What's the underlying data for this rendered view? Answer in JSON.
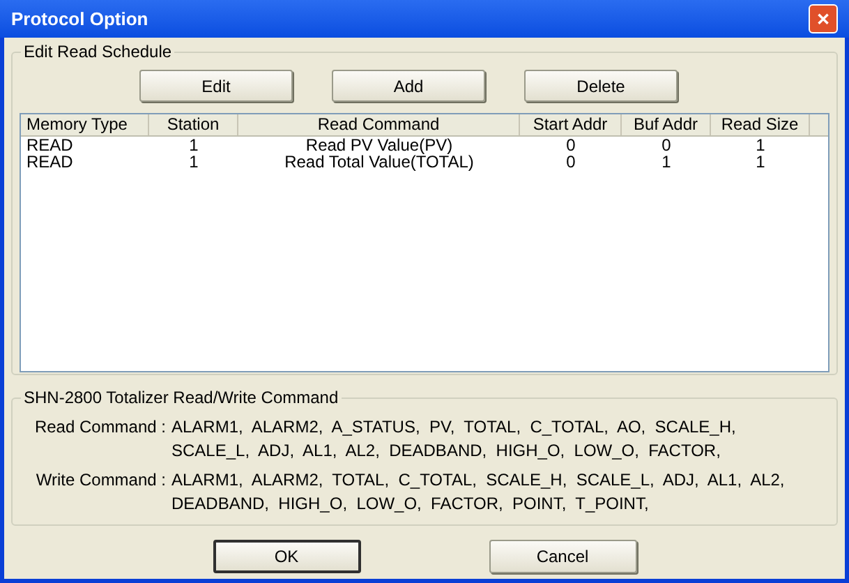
{
  "window": {
    "title": "Protocol Option",
    "close": "✕"
  },
  "schedule": {
    "title": "Edit Read Schedule",
    "buttons": [
      "Edit",
      "Add",
      "Delete"
    ],
    "table": {
      "columns": [
        "Memory Type",
        "Station",
        "Read Command",
        "Start Addr",
        "Buf Addr",
        "Read Size"
      ],
      "rows": [
        [
          "READ",
          "1",
          "Read PV Value(PV)",
          "0",
          "0",
          "1"
        ],
        [
          "READ",
          "1",
          "Read Total Value(TOTAL)",
          "0",
          "1",
          "1"
        ]
      ]
    }
  },
  "commands": {
    "title": "SHN-2800 Totalizer Read/Write Command",
    "items": [
      {
        "label": "Read Command :",
        "value": "ALARM1,  ALARM2,  A_STATUS,  PV,  TOTAL,  C_TOTAL,  AO,  SCALE_H,  SCALE_L,  ADJ,  AL1,  AL2,  DEADBAND,  HIGH_O,  LOW_O,  FACTOR,"
      },
      {
        "label": "Write Command :",
        "value": "ALARM1,  ALARM2,  TOTAL,  C_TOTAL,  SCALE_H,  SCALE_L,  ADJ,  AL1,  AL2,  DEADBAND,  HIGH_O,  LOW_O,  FACTOR,  POINT,  T_POINT,"
      }
    ]
  },
  "footer": [
    {
      "label": "OK",
      "default": true
    },
    {
      "label": "Cancel",
      "default": false
    }
  ]
}
